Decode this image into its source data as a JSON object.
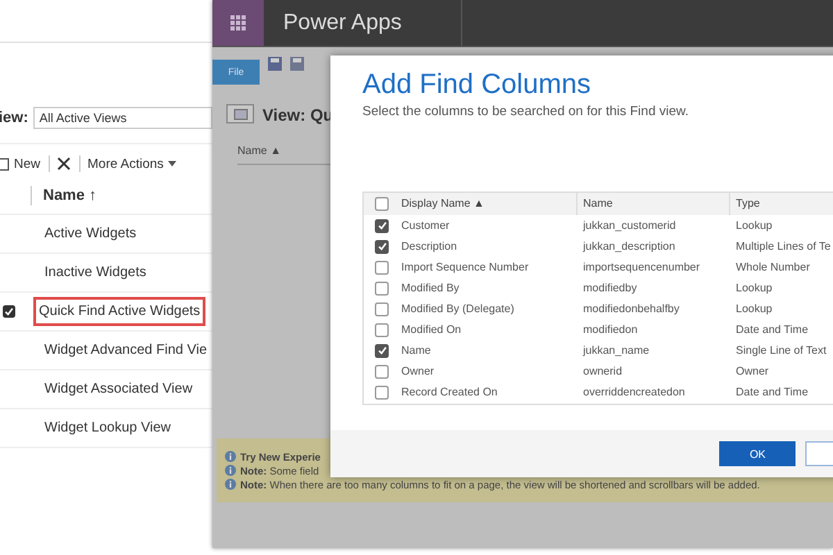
{
  "left_panel": {
    "view_label": "iew:",
    "view_select": "All Active Views",
    "toolbar": [
      {
        "kind": "new",
        "label": "New"
      },
      {
        "kind": "delete"
      },
      {
        "kind": "menu",
        "label": "More Actions"
      }
    ],
    "header": "Name ↑",
    "rows": [
      {
        "name": "Active Widgets",
        "selected": false
      },
      {
        "name": "Inactive Widgets",
        "selected": false
      },
      {
        "name": "Quick Find Active Widgets",
        "selected": true
      },
      {
        "name": "Widget Advanced Find Vie",
        "selected": false
      },
      {
        "name": "Widget Associated View",
        "selected": false
      },
      {
        "name": "Widget Lookup View",
        "selected": false
      }
    ]
  },
  "app_window": {
    "title": "Power Apps",
    "file_tab": "File",
    "view_title": "View: Qu",
    "column_header": "Name ▲",
    "notes": [
      {
        "kind": "heading",
        "text": "Try New Experie"
      },
      {
        "kind": "note",
        "text": "**Note:** Some field"
      },
      {
        "kind": "note",
        "text": "**Note:** When there are too many columns to fit on a page, the view will be shortened and scrollbars will be added."
      }
    ]
  },
  "dialog": {
    "title": "Add Find Columns",
    "subtitle": "Select the columns to be searched on for this Find view.",
    "select_all_checked": false,
    "columns": [
      "Display Name ▲",
      "Name",
      "Type"
    ],
    "rows": [
      {
        "display_name": "Customer",
        "name": "jukkan_customerid",
        "type": "Lookup",
        "checked": true
      },
      {
        "display_name": "Description",
        "name": "jukkan_description",
        "type": "Multiple Lines of Te",
        "checked": true
      },
      {
        "display_name": "Import Sequence Number",
        "name": "importsequencenumber",
        "type": "Whole Number",
        "checked": false
      },
      {
        "display_name": "Modified By",
        "name": "modifiedby",
        "type": "Lookup",
        "checked": false
      },
      {
        "display_name": "Modified By (Delegate)",
        "name": "modifiedonbehalfby",
        "type": "Lookup",
        "checked": false
      },
      {
        "display_name": "Modified On",
        "name": "modifiedon",
        "type": "Date and Time",
        "checked": false
      },
      {
        "display_name": "Name",
        "name": "jukkan_name",
        "type": "Single Line of Text",
        "checked": true
      },
      {
        "display_name": "Owner",
        "name": "ownerid",
        "type": "Owner",
        "checked": false
      },
      {
        "display_name": "Record Created On",
        "name": "overriddencreatedon",
        "type": "Date and Time",
        "checked": false
      }
    ],
    "ok_button": "OK"
  }
}
